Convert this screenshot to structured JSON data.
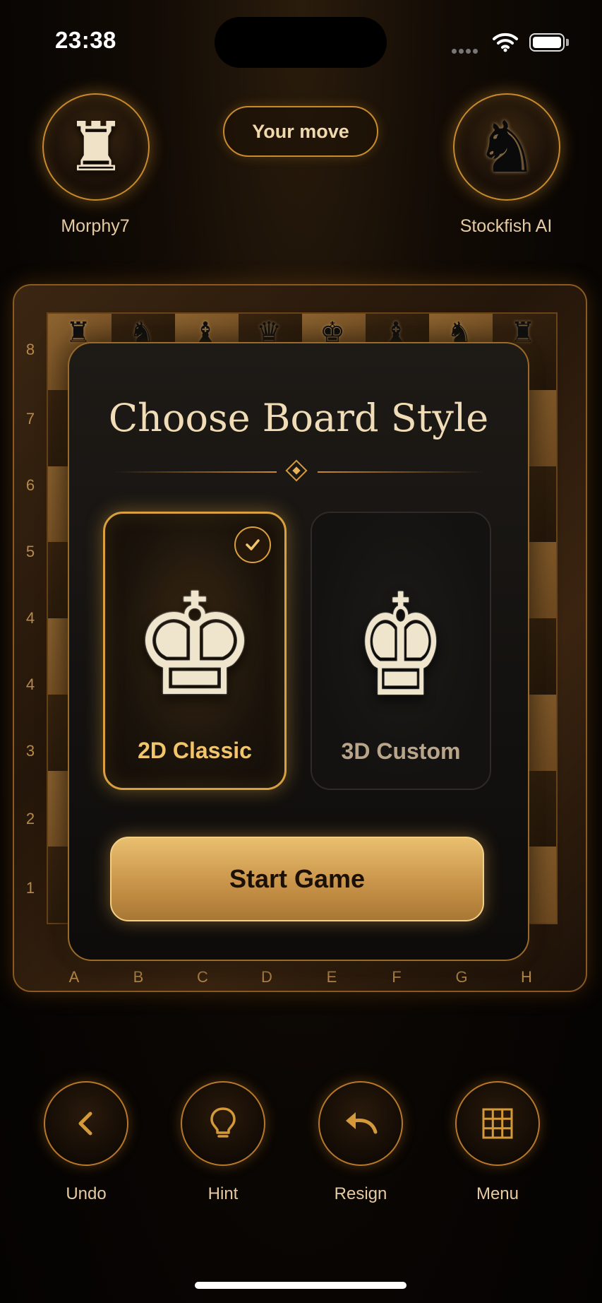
{
  "status_bar": {
    "time": "23:38"
  },
  "players": {
    "left": {
      "name": "Morphy7",
      "piece": "white-rook"
    },
    "right": {
      "name": "Stockfish AI",
      "piece": "black-knight"
    }
  },
  "turn_indicator": "Your move",
  "board": {
    "ranks": [
      "8",
      "7",
      "6",
      "5",
      "4",
      "4",
      "3",
      "2",
      "1"
    ],
    "files": [
      "A",
      "B",
      "C",
      "D",
      "E",
      "F",
      "G",
      "H"
    ]
  },
  "modal": {
    "title": "Choose Board Style",
    "options": [
      {
        "label": "2D Classic",
        "selected": true,
        "icon": "white-king"
      },
      {
        "label": "3D Custom",
        "selected": false,
        "icon": "white-king"
      }
    ],
    "start_button": "Start Game"
  },
  "controls": [
    {
      "label": "Undo",
      "icon": "chevron-left-icon"
    },
    {
      "label": "Hint",
      "icon": "lightbulb-icon"
    },
    {
      "label": "Resign",
      "icon": "undo-arrow-icon"
    },
    {
      "label": "Menu",
      "icon": "grid-icon"
    }
  ],
  "colors": {
    "accent": "#c98a2c",
    "gold_button": "#d9a85c",
    "background": "#0a0604"
  }
}
